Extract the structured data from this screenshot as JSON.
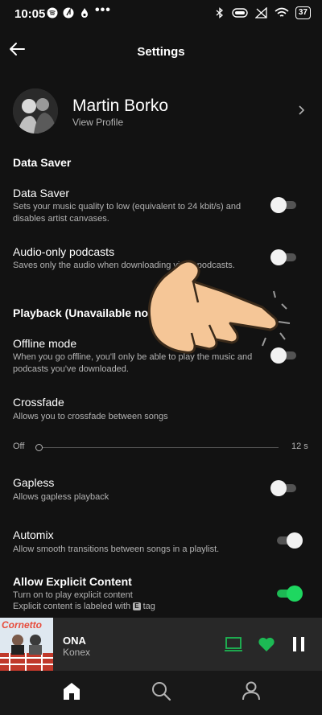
{
  "status_bar": {
    "time": "10:05",
    "dots": "•••",
    "battery": "37"
  },
  "header": {
    "title": "Settings"
  },
  "profile": {
    "name": "Martin Borko",
    "subtitle": "View Profile"
  },
  "data_saver_section": {
    "title": "Data Saver",
    "items": [
      {
        "title": "Data Saver",
        "desc": "Sets your music quality to low (equivalent to 24 kbit/s) and disables artist canvases.",
        "enabled": false
      },
      {
        "title": "Audio-only podcasts",
        "desc": "Saves only the audio when downloading video podcasts.",
        "enabled": false
      }
    ]
  },
  "playback_section": {
    "title": "Playback (Unavailable now)",
    "offline": {
      "title": "Offline mode",
      "desc": "When you go offline, you'll only be able to play the music and podcasts you've downloaded.",
      "enabled": false
    },
    "crossfade": {
      "title": "Crossfade",
      "desc": "Allows you to crossfade between songs",
      "min_label": "Off",
      "max_label": "12 s",
      "value": 0
    },
    "gapless": {
      "title": "Gapless",
      "desc": "Allows gapless playback",
      "enabled": false
    },
    "automix": {
      "title": "Automix",
      "desc": "Allow smooth transitions between songs in a playlist.",
      "enabled": true
    },
    "explicit": {
      "title": "Allow Explicit Content",
      "desc_line1": "Turn on to play explicit content",
      "desc_line2_a": "Explicit content is labeled with",
      "e_tag": "E",
      "desc_line2_b": "tag",
      "enabled": true
    }
  },
  "now_playing": {
    "cover_text": "Cornetto",
    "title": "ONA",
    "artist": "Konex"
  },
  "colors": {
    "accent": "#1db954",
    "background": "#121212",
    "player_bg": "#282828"
  },
  "icons": {
    "back": "arrow-left-icon",
    "chevron": "chevron-right-icon",
    "device": "devices-icon",
    "heart": "heart-icon",
    "pause": "pause-icon",
    "home": "home-icon",
    "search": "search-icon",
    "profile": "person-icon"
  }
}
